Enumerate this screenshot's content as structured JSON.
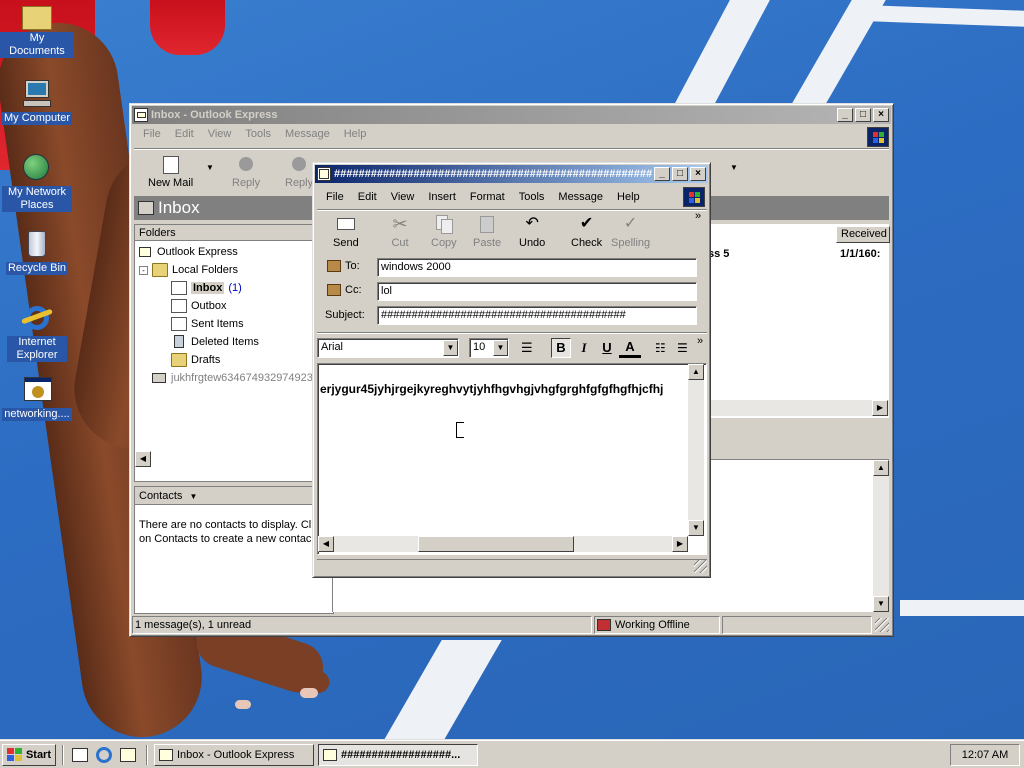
{
  "desktop": {
    "icons": [
      {
        "label": "My Documents",
        "icon": "my-documents-icon"
      },
      {
        "label": "My Computer",
        "icon": "my-computer-icon"
      },
      {
        "label": "My Network Places",
        "icon": "network-places-icon"
      },
      {
        "label": "Recycle Bin",
        "icon": "recycle-bin-icon"
      },
      {
        "label": "Internet Explorer",
        "icon": "internet-explorer-icon"
      },
      {
        "label": "networking....",
        "icon": "networking-shortcut-icon"
      }
    ]
  },
  "outlook": {
    "title": "Inbox - Outlook Express",
    "menu": [
      "File",
      "Edit",
      "View",
      "Tools",
      "Message",
      "Help"
    ],
    "toolbar": {
      "new_mail": "New Mail",
      "reply": "Reply",
      "reply_all": "Reply"
    },
    "header_title": "Inbox",
    "folders_header": "Folders",
    "tree": {
      "root": "Outlook Express",
      "local": "Local Folders",
      "inbox": "Inbox",
      "inbox_count": "(1)",
      "outbox": "Outbox",
      "sent": "Sent Items",
      "deleted": "Deleted Items",
      "drafts": "Drafts",
      "account": "jukhfrgtew634674932974923"
    },
    "contacts_label": "Contacts",
    "contacts_text_1": "There are no contacts to display. Cli",
    "contacts_text_2": "on Contacts to create a new contac",
    "list_header_received": "Received",
    "list_row_subject_fragment": "ss 5",
    "list_row_received": "1/1/160:",
    "status_messages": "1 message(s), 1 unread",
    "status_offline": "Working Offline"
  },
  "compose": {
    "title": "#######################################################",
    "menu": [
      "File",
      "Edit",
      "View",
      "Insert",
      "Format",
      "Tools",
      "Message",
      "Help"
    ],
    "toolbar": {
      "send": "Send",
      "cut": "Cut",
      "copy": "Copy",
      "paste": "Paste",
      "undo": "Undo",
      "check": "Check",
      "spelling": "Spelling"
    },
    "to_label": "To:",
    "to_value": "windows 2000",
    "cc_label": "Cc:",
    "cc_value": "lol",
    "subject_label": "Subject:",
    "subject_value": "########################################",
    "font_name": "Arial",
    "font_size": "10",
    "format_bold": "B",
    "format_italic": "I",
    "format_underline": "U",
    "format_color": "A",
    "body_text": "erjygur45jyhjrgejkyreghvytjyhfhgvhgjvhgfgrghfgfgfhgfhjcfhj"
  },
  "taskbar": {
    "start": "Start",
    "tasks": [
      "Inbox - Outlook Express",
      "##################..."
    ],
    "clock": "12:07 AM"
  }
}
